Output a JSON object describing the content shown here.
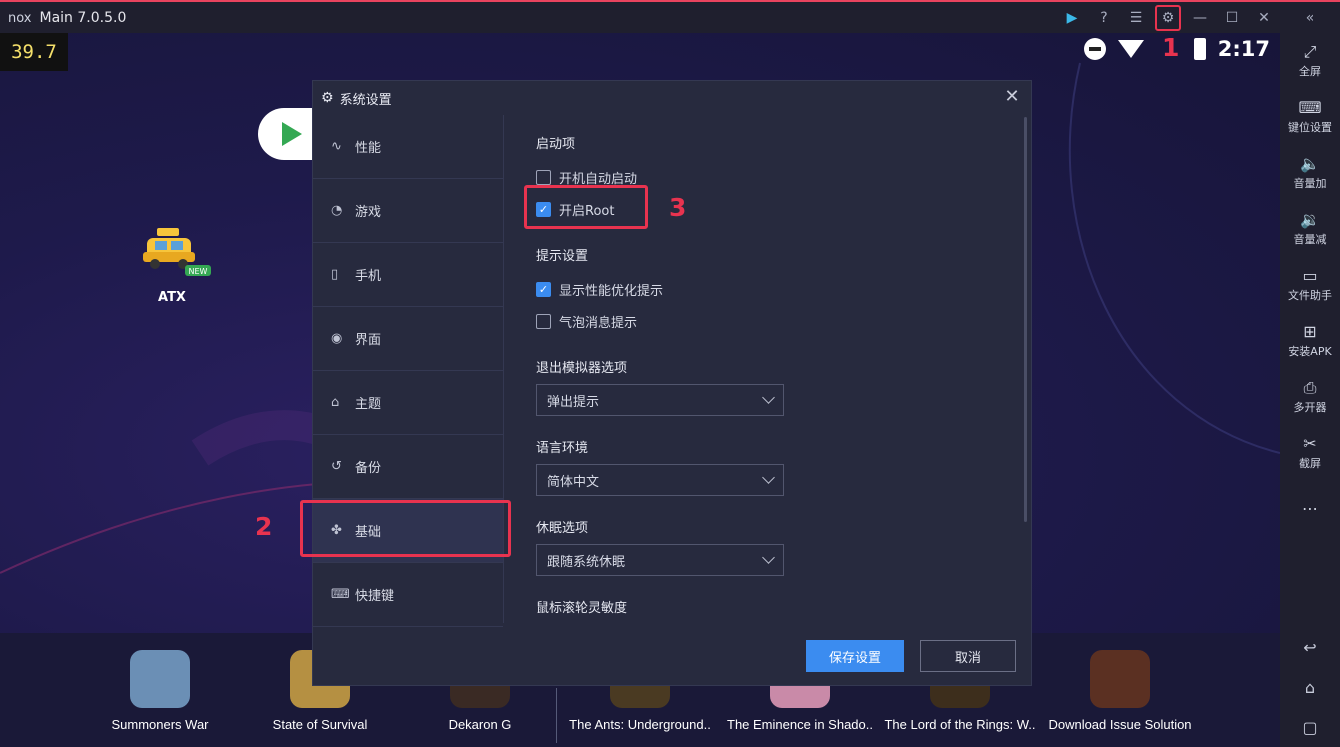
{
  "titlebar": {
    "logo": "nox",
    "title": "Main 7.0.5.0",
    "icons": [
      "play-store-icon",
      "help-icon",
      "menu-icon",
      "gear-icon",
      "minimize-icon",
      "maximize-icon",
      "close-icon",
      "collapse-icon"
    ]
  },
  "fps": "39.7",
  "statusbar": {
    "time": "2:17"
  },
  "desktop": {
    "atx_label": "ATX",
    "atx_badge": "NEW"
  },
  "dock": [
    {
      "label": "Summoners War",
      "color": "#6b8fb5"
    },
    {
      "label": "State of Survival",
      "color": "#b59042"
    },
    {
      "label": "Dekaron G",
      "color": "#3a2a24"
    },
    {
      "label": "The Ants: Underground..",
      "color": "#4a3a22"
    },
    {
      "label": "The Eminence in Shado..",
      "color": "#c98aa8"
    },
    {
      "label": "The Lord of the Rings: W..",
      "color": "#3d2e1c"
    },
    {
      "label": "Download Issue Solution",
      "color": "#5b3022"
    }
  ],
  "sidebar": {
    "items": [
      {
        "icon": "⤢",
        "label": "全屏"
      },
      {
        "icon": "⌨",
        "label": "键位设置"
      },
      {
        "icon": "🔈",
        "label": "音量加"
      },
      {
        "icon": "🔉",
        "label": "音量减"
      },
      {
        "icon": "▭",
        "label": "文件助手"
      },
      {
        "icon": "⊞",
        "label": "安装APK"
      },
      {
        "icon": "⎙",
        "label": "多开器"
      },
      {
        "icon": "✂",
        "label": "截屏"
      },
      {
        "icon": "⋯",
        "label": ""
      }
    ],
    "nav": [
      "↩",
      "⌂",
      "▢"
    ]
  },
  "dialog": {
    "title": "系统设置",
    "nav": [
      {
        "icon": "∿",
        "label": "性能"
      },
      {
        "icon": "◔",
        "label": "游戏"
      },
      {
        "icon": "▯",
        "label": "手机"
      },
      {
        "icon": "◉",
        "label": "界面"
      },
      {
        "icon": "⌂",
        "label": "主题"
      },
      {
        "icon": "↺",
        "label": "备份"
      },
      {
        "icon": "✤",
        "label": "基础"
      },
      {
        "icon": "⌨",
        "label": "快捷键"
      }
    ],
    "startup_header": "启动项",
    "auto_start": "开机自动启动",
    "root": "开启Root",
    "tips_header": "提示设置",
    "perf_tip": "显示性能优化提示",
    "bubble_tip": "气泡消息提示",
    "exit_header": "退出模拟器选项",
    "exit_value": "弹出提示",
    "lang_header": "语言环境",
    "lang_value": "简体中文",
    "sleep_header": "休眠选项",
    "sleep_value": "跟随系统休眠",
    "wheel_header": "鼠标滚轮灵敏度",
    "save": "保存设置",
    "cancel": "取消"
  },
  "annotations": {
    "n1": "1",
    "n2": "2",
    "n3": "3",
    "color": "#e8334f"
  }
}
